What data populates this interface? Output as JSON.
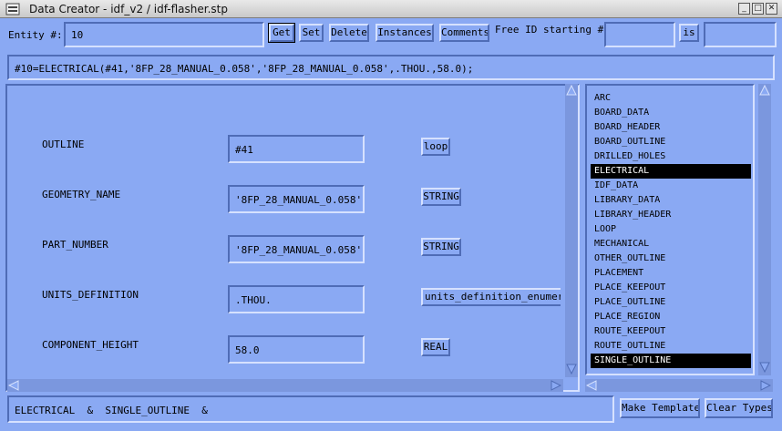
{
  "window": {
    "title": "Data Creator - idf_v2 / idf-flasher.stp"
  },
  "toolbar": {
    "entity_label": "Entity #:",
    "entity_value": "10",
    "buttons": [
      "Get",
      "Set",
      "Delete",
      "Instances",
      "Comments"
    ],
    "free_id_label": "Free ID starting #:",
    "free_id_value": "",
    "is_button": "is",
    "is_value": ""
  },
  "record_text": "#10=ELECTRICAL(#41,'8FP_28_MANUAL_0.058','8FP_28_MANUAL_0.058',.THOU.,58.0);",
  "attributes": [
    {
      "name": "OUTLINE",
      "value": "#41",
      "type": "loop"
    },
    {
      "name": "GEOMETRY_NAME",
      "value": "'8FP_28_MANUAL_0.058'",
      "type": "STRING"
    },
    {
      "name": "PART_NUMBER",
      "value": "'8FP_28_MANUAL_0.058'",
      "type": "STRING"
    },
    {
      "name": "UNITS_DEFINITION",
      "value": ".THOU.",
      "type": "units_definition_enumerat"
    },
    {
      "name": "COMPONENT_HEIGHT",
      "value": "58.0",
      "type": "REAL"
    }
  ],
  "types_list": {
    "items": [
      "ARC",
      "BOARD_DATA",
      "BOARD_HEADER",
      "BOARD_OUTLINE",
      "DRILLED_HOLES",
      "ELECTRICAL",
      "IDF_DATA",
      "LIBRARY_DATA",
      "LIBRARY_HEADER",
      "LOOP",
      "MECHANICAL",
      "OTHER_OUTLINE",
      "PLACEMENT",
      "PLACE_KEEPOUT",
      "PLACE_OUTLINE",
      "PLACE_REGION",
      "ROUTE_KEEPOUT",
      "ROUTE_OUTLINE",
      "SINGLE_OUTLINE"
    ],
    "selected": [
      "ELECTRICAL",
      "SINGLE_OUTLINE"
    ]
  },
  "status": {
    "types_text": "ELECTRICAL  &  SINGLE_OUTLINE  &",
    "make_template_label": "Make Template",
    "clear_types_label": "Clear Types"
  },
  "colors": {
    "background": "#8aa9f3",
    "selection": "#000000"
  }
}
